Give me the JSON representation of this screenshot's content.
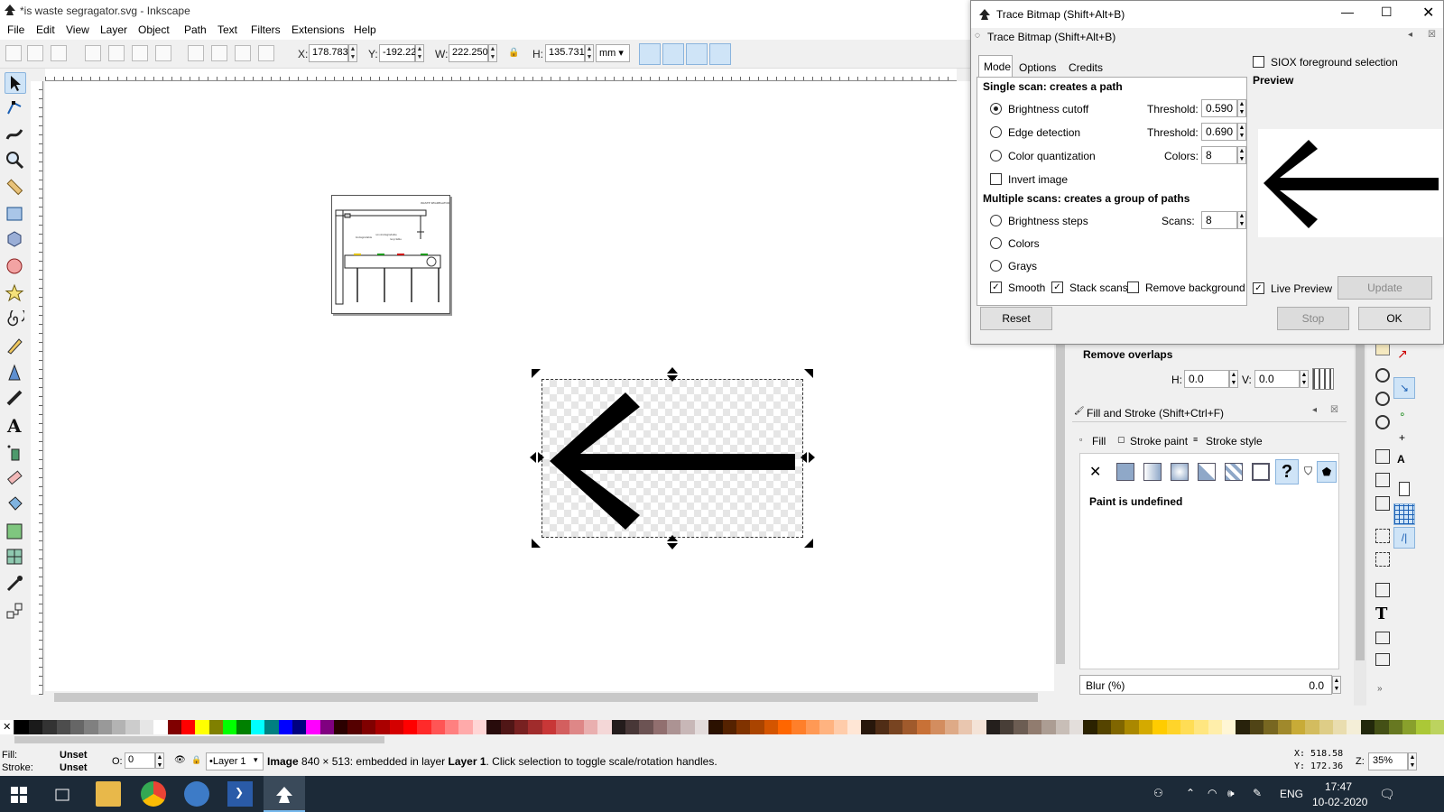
{
  "window": {
    "title": "*is waste segragator.svg - Inkscape"
  },
  "menu": [
    "File",
    "Edit",
    "View",
    "Layer",
    "Object",
    "Path",
    "Text",
    "Filters",
    "Extensions",
    "Help"
  ],
  "toolbar": {
    "x_label": "X:",
    "x_value": "178.783",
    "y_label": "Y:",
    "y_value": "-192.22",
    "w_label": "W:",
    "w_value": "222.250",
    "h_label": "H:",
    "h_value": "135.731",
    "unit": "mm"
  },
  "trace_dialog": {
    "window_title": "Trace Bitmap (Shift+Alt+B)",
    "panel_title": "Trace Bitmap (Shift+Alt+B)",
    "tabs": [
      "Mode",
      "Options",
      "Credits"
    ],
    "single_scan_header": "Single scan: creates a path",
    "brightness_cutoff": "Brightness cutoff",
    "threshold_label": "Threshold:",
    "brightness_threshold": "0.590",
    "edge_detection": "Edge detection",
    "edge_threshold": "0.690",
    "color_quantization": "Color quantization",
    "colors_label": "Colors:",
    "colors_value": "8",
    "invert_image": "Invert image",
    "multiple_scans_header": "Multiple scans: creates a group of paths",
    "brightness_steps": "Brightness steps",
    "scans_label": "Scans:",
    "scans_value": "8",
    "colors_option": "Colors",
    "grays_option": "Grays",
    "smooth": "Smooth",
    "stack_scans": "Stack scans",
    "remove_background": "Remove background",
    "siox": "SIOX foreground selection",
    "preview_label": "Preview",
    "live_preview": "Live Preview",
    "update_button": "Update",
    "reset_button": "Reset",
    "stop_button": "Stop",
    "ok_button": "OK"
  },
  "align_panel": {
    "remove_overlaps": "Remove overlaps",
    "h_label": "H:",
    "h_value": "0.0",
    "v_label": "V:",
    "v_value": "0.0"
  },
  "fill_stroke": {
    "title": "Fill and Stroke (Shift+Ctrl+F)",
    "tabs": [
      "Fill",
      "Stroke paint",
      "Stroke style"
    ],
    "paint_status": "Paint is undefined",
    "blur_label": "Blur (%)",
    "blur_value": "0.0"
  },
  "status": {
    "fill_label": "Fill:",
    "fill_value": "Unset",
    "stroke_label": "Stroke:",
    "stroke_value": "Unset",
    "opacity_label": "O:",
    "opacity_value": "0",
    "layer": "•Layer 1",
    "message_bold": "Image",
    "message": " 840 × 513: embedded in layer ",
    "message_layer": "Layer 1",
    "message_end": ". Click selection to toggle scale/rotation handles.",
    "cursor_x": "X:  518.58",
    "cursor_y": "Y:  172.36",
    "zoom_label": "Z:",
    "zoom_value": "35%"
  },
  "taskbar": {
    "language": "ENG",
    "time": "17:47",
    "date": "10-02-2020"
  },
  "thumbnail": {
    "title_text": "WASTE SEGREGATOR",
    "labels": [
      "biodegradable",
      "non-biodegradable",
      "recyclable"
    ]
  },
  "palette_colors": [
    "#000000",
    "#1a1a1a",
    "#333333",
    "#4d4d4d",
    "#666666",
    "#808080",
    "#999999",
    "#b3b3b3",
    "#cccccc",
    "#e6e6e6",
    "#ffffff",
    "#800000",
    "#ff0000",
    "#ffff00",
    "#808000",
    "#00ff00",
    "#008000",
    "#00ffff",
    "#008080",
    "#0000ff",
    "#000080",
    "#ff00ff",
    "#800080",
    "#2b0000",
    "#550000",
    "#800000",
    "#aa0000",
    "#d40000",
    "#ff0000",
    "#ff2a2a",
    "#ff5555",
    "#ff8080",
    "#ffaaaa",
    "#ffd5d5",
    "#280b0b",
    "#501616",
    "#782121",
    "#a02c2c",
    "#c83737",
    "#d35f5f",
    "#de8787",
    "#e9afaf",
    "#f4d7d7",
    "#241c1c",
    "#483737",
    "#6c5353",
    "#916f6f",
    "#ac9393",
    "#c8b7b7",
    "#e3dbdb",
    "#2b1100",
    "#552200",
    "#803300",
    "#aa4400",
    "#d45500",
    "#ff6600",
    "#ff7f2a",
    "#ff9955",
    "#ffb380",
    "#ffccaa",
    "#ffe6d5",
    "#28170b",
    "#502d16",
    "#784421",
    "#a05a2c",
    "#c87137",
    "#d38d5f",
    "#deaa87",
    "#e9c6af",
    "#f4e3d7",
    "#241f1c",
    "#483e37",
    "#6c5d53",
    "#917c6f",
    "#ac9d93",
    "#c8beb7",
    "#e3dedb",
    "#2b2200",
    "#554400",
    "#806600",
    "#aa8800",
    "#d4aa00",
    "#ffcc00",
    "#ffd42a",
    "#ffdd55",
    "#ffe680",
    "#ffeeaa",
    "#fff6d5",
    "#28220b",
    "#504416",
    "#786721",
    "#a0892c",
    "#c8ab37",
    "#d3bc5f",
    "#decd87",
    "#e9ddaf",
    "#f4eed7",
    "#22280b",
    "#445016",
    "#677821",
    "#89a02c",
    "#abc837",
    "#bcd35f"
  ]
}
